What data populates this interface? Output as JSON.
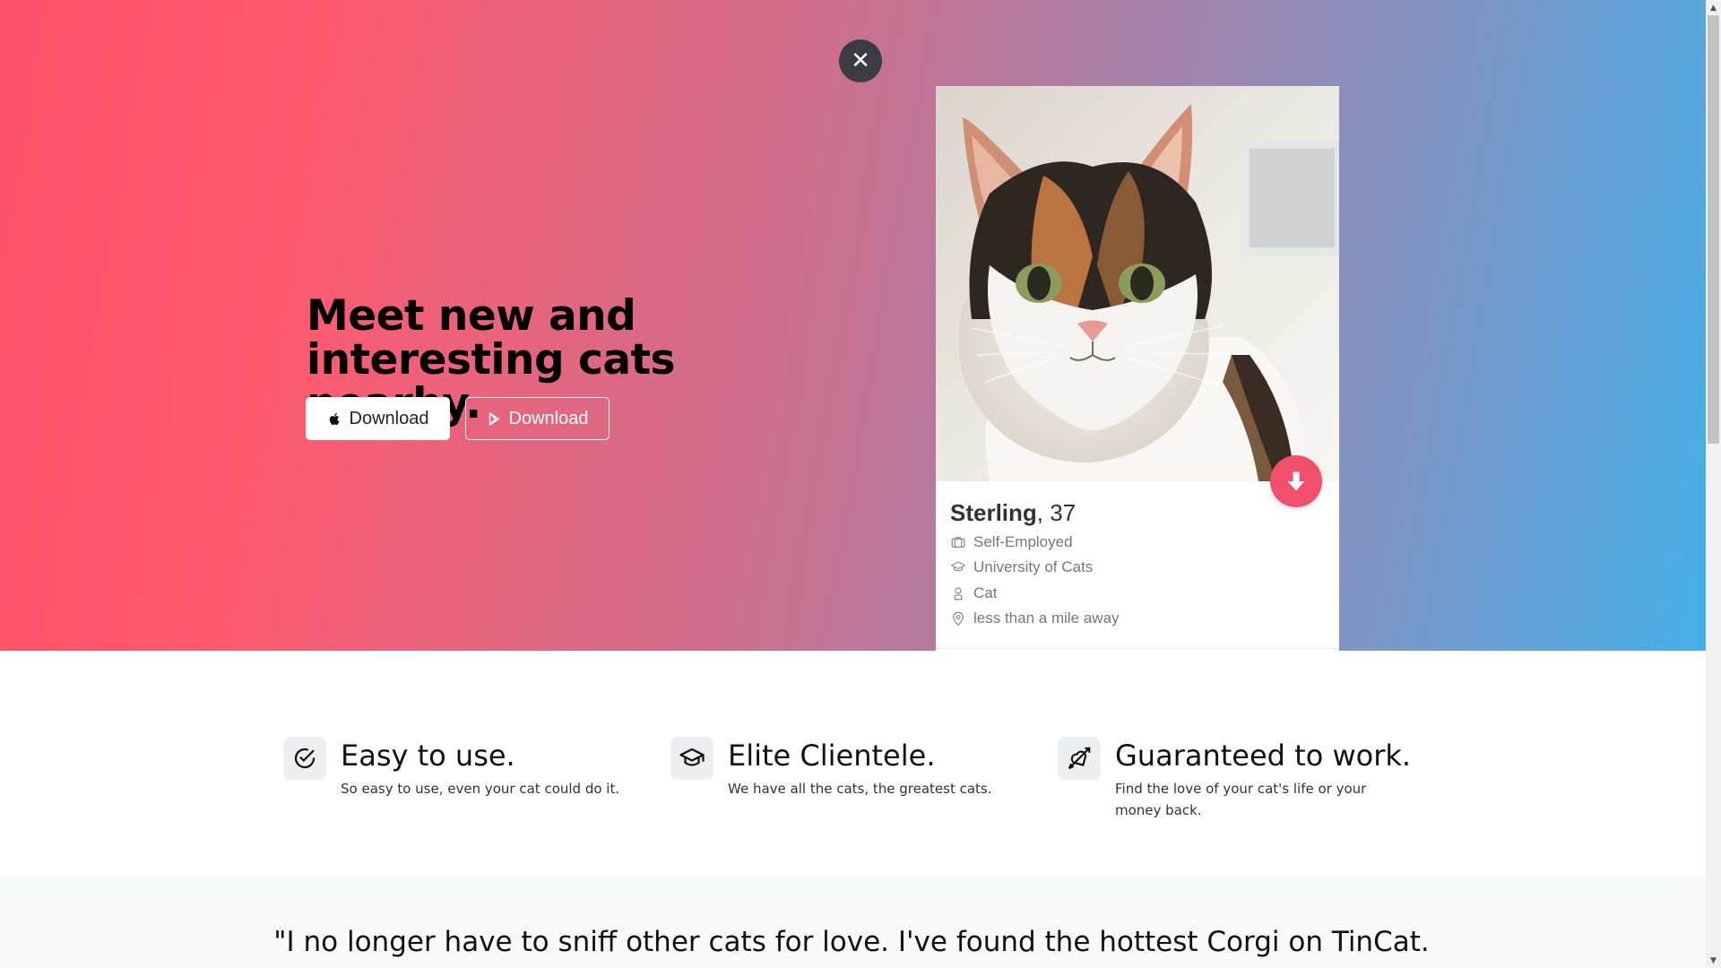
{
  "hero": {
    "close_symbol": "✕",
    "headline": "Meet new and interesting cats nearby.",
    "buttons": [
      {
        "label": "Download",
        "icon": "apple-icon"
      },
      {
        "label": "Download",
        "icon": "google-play-icon"
      }
    ],
    "gradient": [
      "#fe5068",
      "#45afe9"
    ]
  },
  "profile": {
    "name": "Sterling",
    "age": ", 37",
    "details": [
      {
        "icon": "briefcase-icon",
        "text": "Self-Employed"
      },
      {
        "icon": "graduation-cap-icon",
        "text": "University of Cats"
      },
      {
        "icon": "user-icon",
        "text": "Cat"
      },
      {
        "icon": "map-pin-icon",
        "text": "less than a mile away"
      }
    ],
    "like_color": "#f0506b"
  },
  "features": [
    {
      "icon": "check-circle-icon",
      "title": "Easy to use.",
      "text": "So easy to use, even your cat could do it."
    },
    {
      "icon": "graduation-cap-icon",
      "title": "Elite Clientele.",
      "text": "We have all the cats, the greatest cats."
    },
    {
      "icon": "heart-arrow-icon",
      "title": "Guaranteed to work.",
      "text": "Find the love of your cat's life or your money back."
    }
  ],
  "testimonial": {
    "quote": "\"I no longer have to sniff other cats for love. I've found the hottest Corgi on TinCat. Meow.\""
  }
}
